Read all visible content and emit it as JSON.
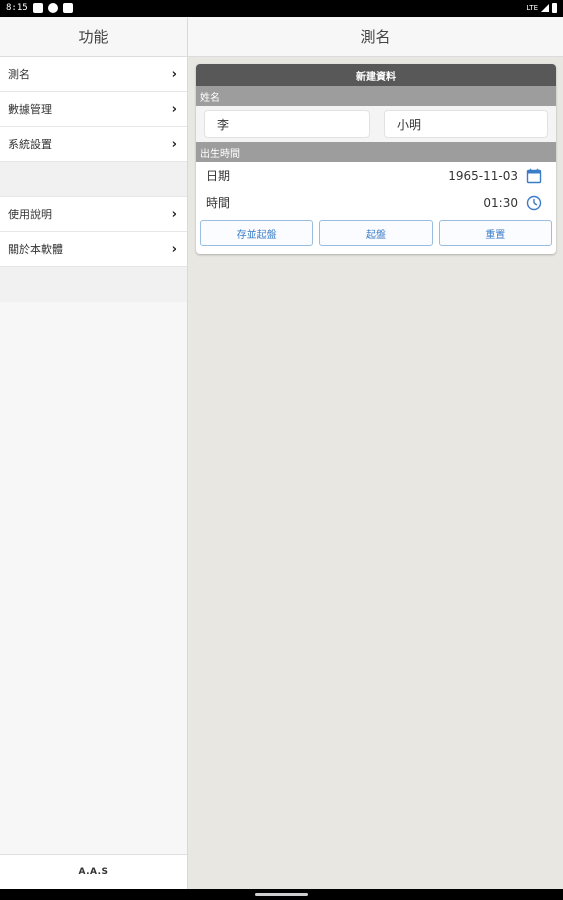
{
  "status": {
    "time": "8:15",
    "network": "LTE"
  },
  "sidebar": {
    "title": "功能",
    "items": [
      {
        "label": "測名"
      },
      {
        "label": "數據管理"
      },
      {
        "label": "系統設置"
      },
      {
        "label": "使用說明"
      },
      {
        "label": "關於本軟體"
      }
    ],
    "footer": "A.A.S"
  },
  "main": {
    "title": "測名",
    "card_title": "新建資料",
    "name_section": "姓名",
    "surname": "李",
    "given_name": "小明",
    "birth_section": "出生時間",
    "date_label": "日期",
    "date_value": "1965-11-03",
    "time_label": "時間",
    "time_value": "01:30",
    "buttons": {
      "save_and_start": "存並起盤",
      "start": "起盤",
      "reset": "重置"
    }
  },
  "colors": {
    "accent": "#3a7cc7",
    "card_header": "#585858",
    "section_header": "#9d9d9d",
    "main_bg": "#e9e7e2"
  }
}
